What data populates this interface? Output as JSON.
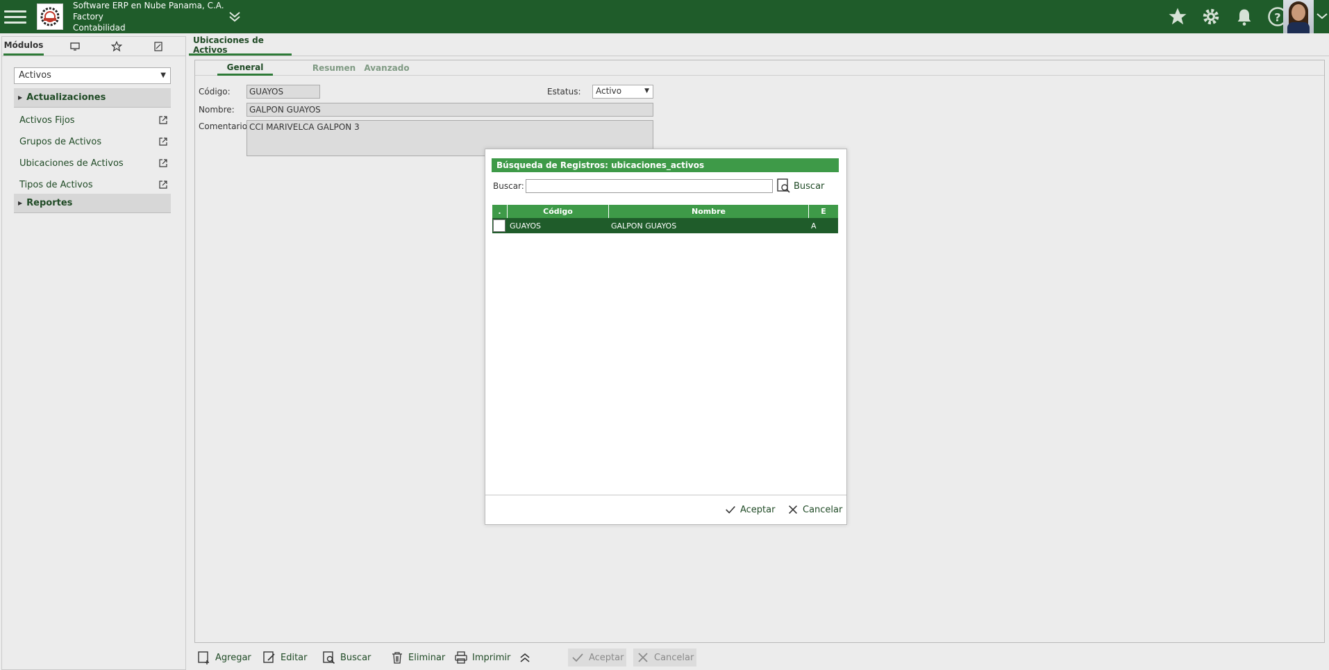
{
  "header": {
    "company": "Software ERP en Nube Panama, C.A.",
    "line2": "Factory",
    "line3": "Contabilidad"
  },
  "left": {
    "tabs": [
      "Módulos"
    ],
    "module_value": "Activos",
    "sections": [
      {
        "label": "Actualizaciones"
      },
      {
        "label": "Reportes"
      }
    ],
    "items": [
      {
        "label": "Activos Fijos"
      },
      {
        "label": "Grupos de Activos"
      },
      {
        "label": "Ubicaciones de Activos"
      },
      {
        "label": "Tipos de Activos"
      }
    ]
  },
  "main": {
    "title": "Ubicaciones de Activos",
    "tabs": [
      {
        "label": "General"
      },
      {
        "label": "Resumen"
      },
      {
        "label": "Avanzado"
      }
    ],
    "form": {
      "codigo_label": "Código:",
      "codigo_value": "GUAYOS",
      "estatus_label": "Estatus:",
      "estatus_value": "Activo",
      "nombre_label": "Nombre:",
      "nombre_value": "GALPON GUAYOS",
      "comentario_label": "Comentario:",
      "comentario_value": "CCI MARIVELCA GALPON 3"
    },
    "toolbar": {
      "agregar": "Agregar",
      "editar": "Editar",
      "buscar": "Buscar",
      "eliminar": "Eliminar",
      "imprimir": "Imprimir",
      "aceptar": "Aceptar",
      "cancelar": "Cancelar"
    }
  },
  "modal": {
    "title": "Búsqueda de Registros: ubicaciones_activos",
    "search_label": "Buscar:",
    "search_value": "",
    "search_button": "Buscar",
    "columns": [
      ".",
      "Código",
      "Nombre",
      "E"
    ],
    "rows": [
      {
        "codigo": "GUAYOS",
        "nombre": "GALPON GUAYOS",
        "e": "A"
      }
    ],
    "accept": "Aceptar",
    "cancel": "Cancelar"
  },
  "colors": {
    "topbar": "#1f5c2a",
    "accent": "#3e9a48",
    "text_green": "#1f4a25"
  },
  "icons": [
    "hamburger-icon",
    "company-logo",
    "chevron-down-icon",
    "star-icon",
    "gear-icon",
    "bell-icon",
    "help-icon",
    "avatar",
    "monitor-icon",
    "favorites-icon",
    "tools-icon",
    "external-link-icon",
    "add-icon",
    "edit-icon",
    "search-icon",
    "trash-icon",
    "print-icon",
    "chevron-up-double-icon",
    "check-icon",
    "close-icon"
  ]
}
